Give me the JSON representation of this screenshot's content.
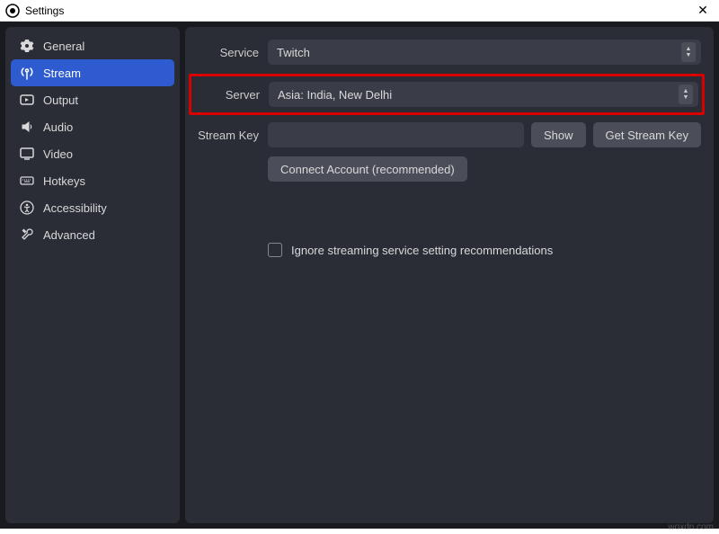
{
  "window": {
    "title": "Settings"
  },
  "sidebar": {
    "items": [
      {
        "label": "General"
      },
      {
        "label": "Stream"
      },
      {
        "label": "Output"
      },
      {
        "label": "Audio"
      },
      {
        "label": "Video"
      },
      {
        "label": "Hotkeys"
      },
      {
        "label": "Accessibility"
      },
      {
        "label": "Advanced"
      }
    ]
  },
  "stream": {
    "service_label": "Service",
    "service_value": "Twitch",
    "server_label": "Server",
    "server_value": "Asia: India, New Delhi",
    "stream_key_label": "Stream Key",
    "stream_key_value": "",
    "show_button": "Show",
    "get_key_button": "Get Stream Key",
    "connect_button": "Connect Account (recommended)",
    "ignore_checkbox_label": "Ignore streaming service setting recommendations"
  },
  "watermark": "woxdn.com"
}
